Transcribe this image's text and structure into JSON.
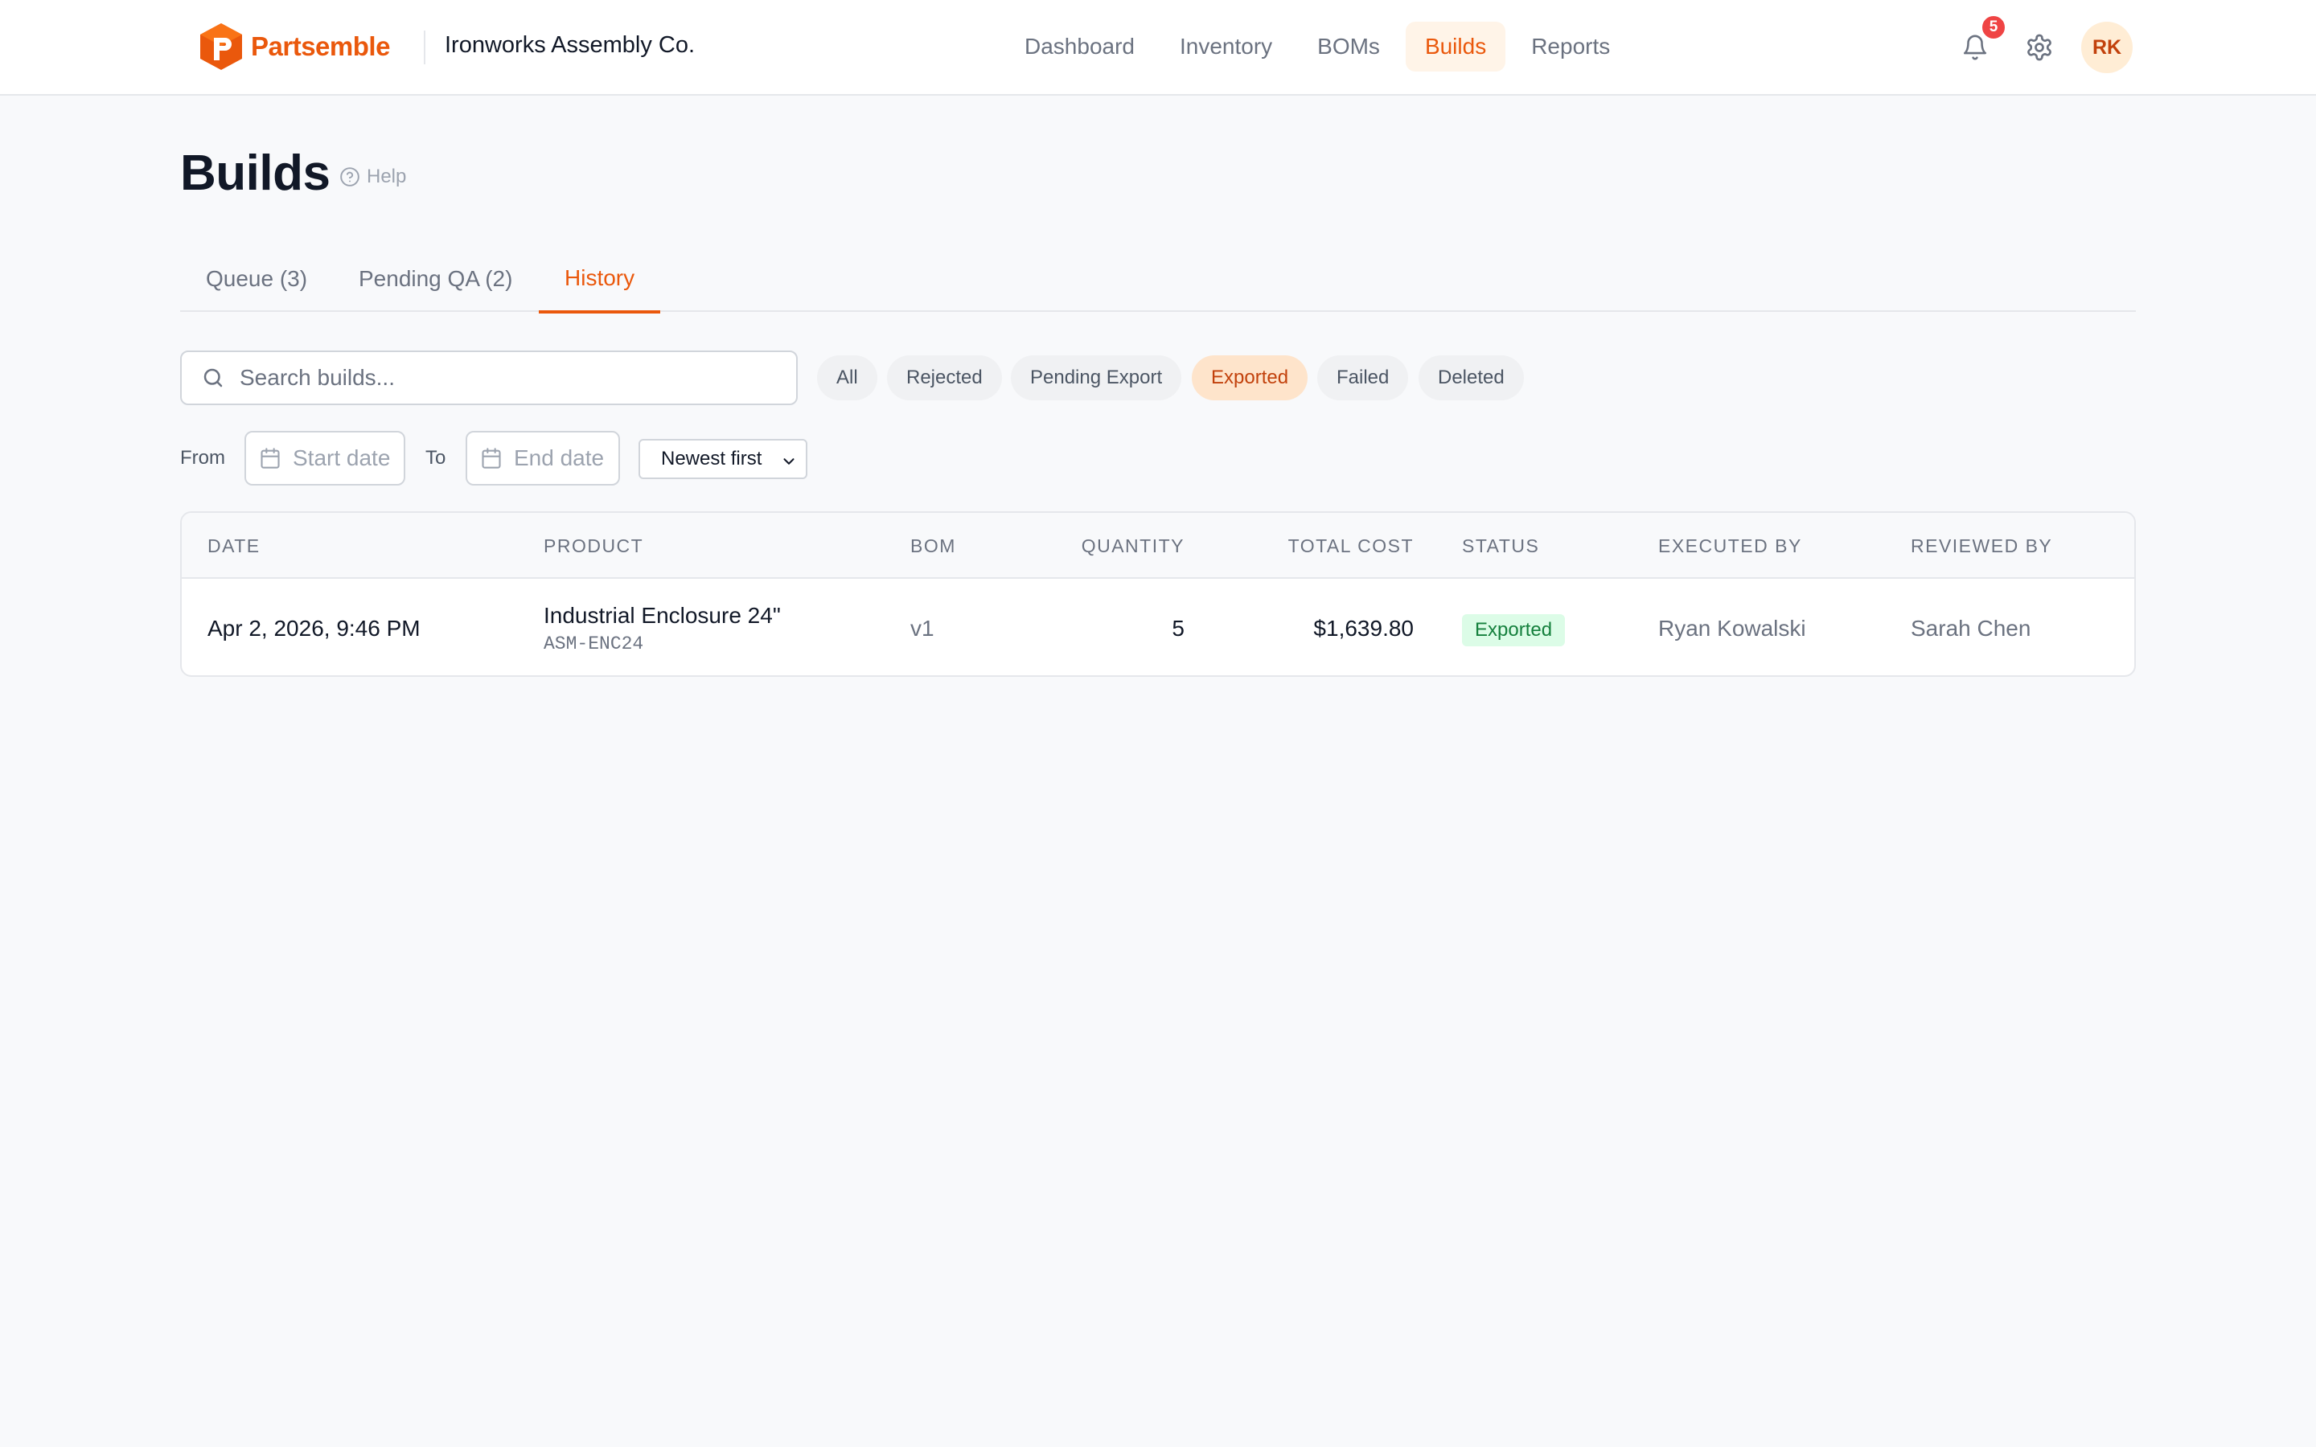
{
  "app": {
    "brand": "Partsemble",
    "org": "Ironworks Assembly Co.",
    "brand_color": "#ea580c"
  },
  "nav": {
    "items": [
      {
        "label": "Dashboard",
        "active": false
      },
      {
        "label": "Inventory",
        "active": false
      },
      {
        "label": "BOMs",
        "active": false
      },
      {
        "label": "Builds",
        "active": true
      },
      {
        "label": "Reports",
        "active": false
      }
    ]
  },
  "header": {
    "notifications_count": "5",
    "notification_icon": "bell-icon",
    "settings_icon": "gear-icon",
    "avatar_initials": "RK"
  },
  "page": {
    "title": "Builds",
    "help_label": "Help"
  },
  "tabs": [
    {
      "label": "Queue (3)",
      "active": false
    },
    {
      "label": "Pending QA (2)",
      "active": false
    },
    {
      "label": "History",
      "active": true
    }
  ],
  "filters": {
    "search_placeholder": "Search builds...",
    "status_chips": [
      {
        "label": "All",
        "active": false
      },
      {
        "label": "Rejected",
        "active": false
      },
      {
        "label": "Pending Export",
        "active": false
      },
      {
        "label": "Exported",
        "active": true
      },
      {
        "label": "Failed",
        "active": false
      },
      {
        "label": "Deleted",
        "active": false
      }
    ],
    "from_label": "From",
    "start_placeholder": "Start date",
    "to_label": "To",
    "end_placeholder": "End date",
    "sort_value": "Newest first"
  },
  "table": {
    "columns": [
      "DATE",
      "PRODUCT",
      "BOM",
      "QUANTITY",
      "TOTAL COST",
      "STATUS",
      "EXECUTED BY",
      "REVIEWED BY"
    ],
    "rows": [
      {
        "date": "Apr 2, 2026, 9:46 PM",
        "product": "Industrial Enclosure 24\"",
        "sku": "ASM-ENC24",
        "bom": "v1",
        "quantity": "5",
        "total_cost": "$1,639.80",
        "status": "Exported",
        "executed_by": "Ryan Kowalski",
        "reviewed_by": "Sarah Chen"
      }
    ]
  }
}
